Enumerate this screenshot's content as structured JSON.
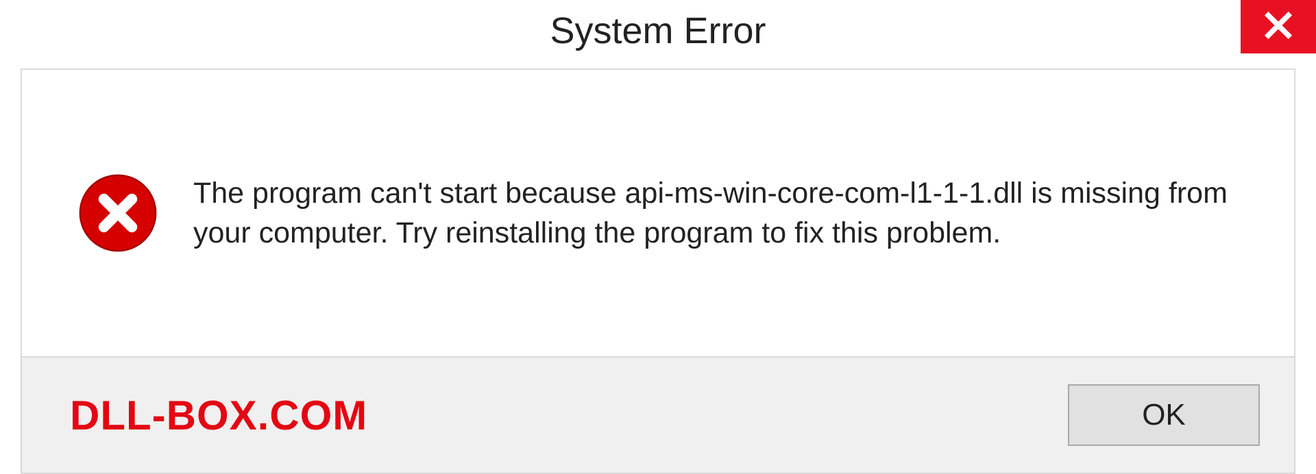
{
  "titlebar": {
    "title": "System Error"
  },
  "message": {
    "text": "The program can't start because api-ms-win-core-com-l1-1-1.dll is missing from your computer. Try reinstalling the program to fix this problem."
  },
  "footer": {
    "watermark": "DLL-BOX.COM",
    "ok_label": "OK"
  },
  "colors": {
    "close_bg": "#e81123",
    "error_icon": "#d50000",
    "watermark": "#e30613"
  }
}
